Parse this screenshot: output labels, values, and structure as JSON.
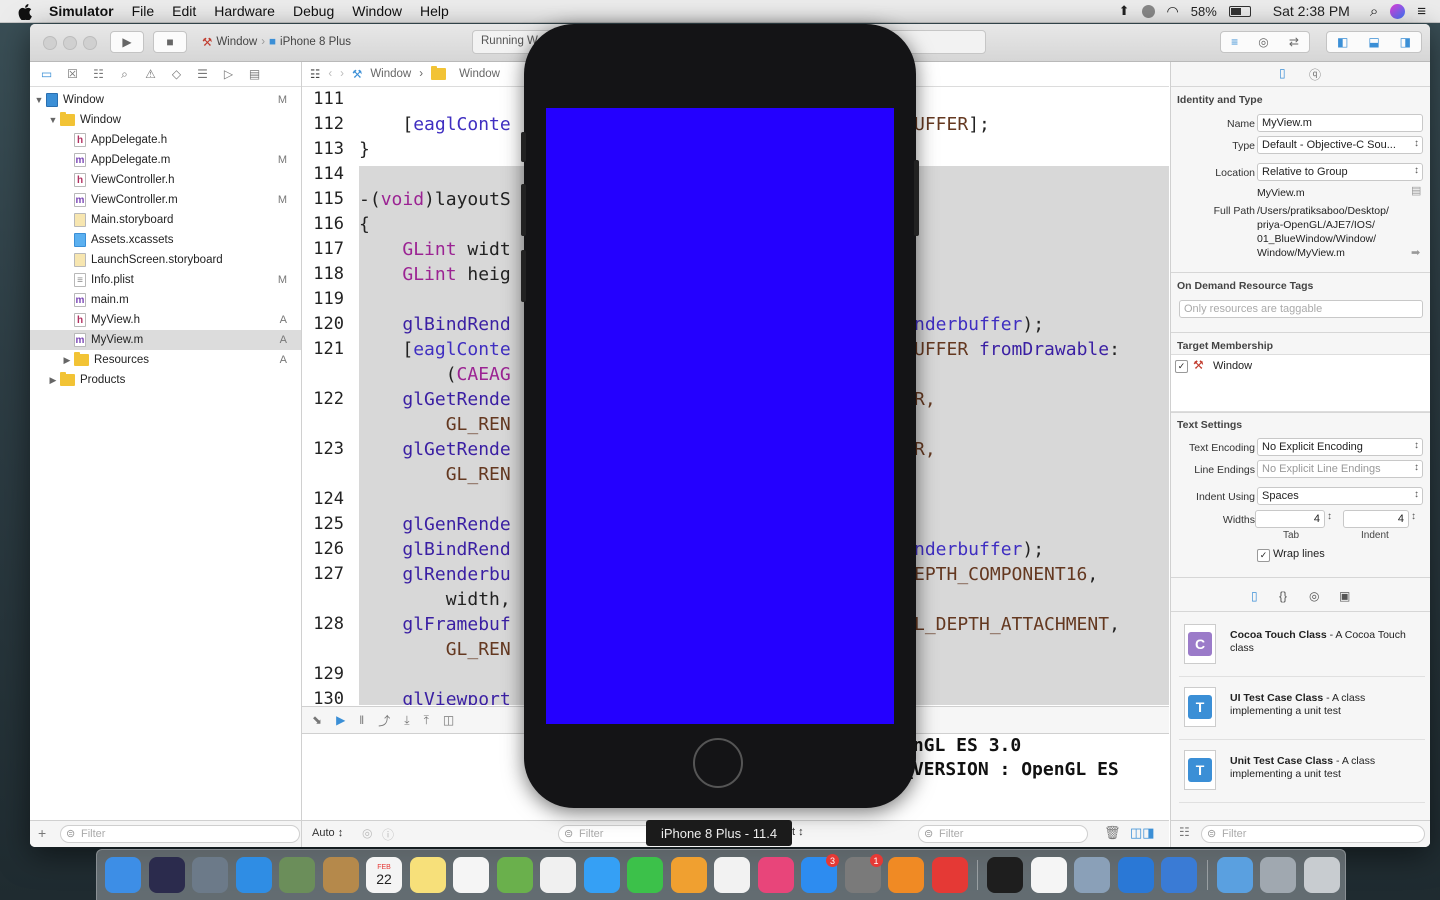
{
  "menubar": {
    "app_name": "Simulator",
    "items": [
      "File",
      "Edit",
      "Hardware",
      "Debug",
      "Window",
      "Help"
    ],
    "battery": "58%",
    "clock": "Sat 2:38 PM"
  },
  "toolbar": {
    "scheme": "Window",
    "device": "iPhone 8 Plus",
    "status": "Running W"
  },
  "navigator": {
    "items": [
      {
        "name": "Window",
        "badge": "M",
        "kind": "project"
      },
      {
        "name": "Window",
        "badge": "",
        "kind": "folder"
      },
      {
        "name": "AppDelegate.h",
        "badge": "",
        "kind": "h"
      },
      {
        "name": "AppDelegate.m",
        "badge": "M",
        "kind": "m"
      },
      {
        "name": "ViewController.h",
        "badge": "",
        "kind": "h"
      },
      {
        "name": "ViewController.m",
        "badge": "M",
        "kind": "m"
      },
      {
        "name": "Main.storyboard",
        "badge": "",
        "kind": "sb"
      },
      {
        "name": "Assets.xcassets",
        "badge": "",
        "kind": "assets"
      },
      {
        "name": "LaunchScreen.storyboard",
        "badge": "",
        "kind": "sb"
      },
      {
        "name": "Info.plist",
        "badge": "M",
        "kind": "plist"
      },
      {
        "name": "main.m",
        "badge": "",
        "kind": "m"
      },
      {
        "name": "MyView.h",
        "badge": "A",
        "kind": "h"
      },
      {
        "name": "MyView.m",
        "badge": "A",
        "kind": "m"
      },
      {
        "name": "Resources",
        "badge": "A",
        "kind": "folder"
      },
      {
        "name": "Products",
        "badge": "",
        "kind": "folder"
      }
    ],
    "filter_placeholder": "Filter"
  },
  "jumpbar": {
    "crumbs": [
      "Window",
      "Window"
    ]
  },
  "code": {
    "lines": [
      {
        "n": "111",
        "t": ""
      },
      {
        "n": "112",
        "t": "    [eaglConte"
      },
      {
        "n": "113",
        "t": "}"
      },
      {
        "n": "114",
        "t": ""
      },
      {
        "n": "115",
        "t": "-(void)layoutS"
      },
      {
        "n": "116",
        "t": "{"
      },
      {
        "n": "117",
        "t": "    GLint widt"
      },
      {
        "n": "118",
        "t": "    GLint heig"
      },
      {
        "n": "119",
        "t": ""
      },
      {
        "n": "120",
        "t": "    glBindRend"
      },
      {
        "n": "121",
        "t": "    [eaglConte"
      },
      {
        "n": "",
        "t": "        (CAEAG"
      },
      {
        "n": "122",
        "t": "    glGetRende"
      },
      {
        "n": "",
        "t": "        GL_REN"
      },
      {
        "n": "123",
        "t": "    glGetRende"
      },
      {
        "n": "",
        "t": "        GL_REN"
      },
      {
        "n": "124",
        "t": ""
      },
      {
        "n": "125",
        "t": "    glGenRende"
      },
      {
        "n": "126",
        "t": "    glBindRend"
      },
      {
        "n": "127",
        "t": "    glRenderbu"
      },
      {
        "n": "",
        "t": "        width,"
      },
      {
        "n": "128",
        "t": "    glFramebuf"
      },
      {
        "n": "",
        "t": "        GL_REN"
      },
      {
        "n": "129",
        "t": ""
      },
      {
        "n": "130",
        "t": "    glViewport"
      }
    ],
    "right_fragments": [
      {
        "row": 1,
        "t": "UFFER];"
      },
      {
        "row": 9,
        "t": "nderbuffer);"
      },
      {
        "row": 10,
        "t": "UFFER fromDrawable:"
      },
      {
        "row": 12,
        "t": "R,"
      },
      {
        "row": 14,
        "t": "R,"
      },
      {
        "row": 18,
        "t": "nderbuffer);"
      },
      {
        "row": 19,
        "t": "EPTH_COMPONENT16,"
      },
      {
        "row": 21,
        "t": "L_DEPTH_ATTACHMENT,"
      }
    ]
  },
  "console": {
    "line1": "enGL ES 3.0",
    "line2": "_VERSION : OpenGL ES"
  },
  "editor_bottom": {
    "auto_label": "Auto",
    "filter1": "Filter",
    "filter2": "Filter",
    "filter_frag": "t"
  },
  "inspector": {
    "identity_header": "Identity and Type",
    "name_label": "Name",
    "name_value": "MyView.m",
    "type_label": "Type",
    "type_value": "Default - Objective-C Sou...",
    "location_label": "Location",
    "location_value": "Relative to Group",
    "location_file": "MyView.m",
    "fullpath_label": "Full Path",
    "fullpath_lines": [
      "/Users/pratiksaboo/Desktop/",
      "priya-OpenGL/AJE7/IOS/",
      "01_BlueWindow/Window/",
      "Window/MyView.m"
    ],
    "ondemand_header": "On Demand Resource Tags",
    "tags_placeholder": "Only resources are taggable",
    "target_header": "Target Membership",
    "target_name": "Window",
    "text_header": "Text Settings",
    "encoding_label": "Text Encoding",
    "encoding_value": "No Explicit Encoding",
    "endings_label": "Line Endings",
    "endings_value": "No Explicit Line Endings",
    "indent_label": "Indent Using",
    "indent_value": "Spaces",
    "widths_label": "Widths",
    "tab_value": "4",
    "indent_width_value": "4",
    "tab_caption": "Tab",
    "indent_caption": "Indent",
    "wrap_label": "Wrap lines",
    "library": [
      {
        "title": "Cocoa Touch Class",
        "desc": " - A Cocoa Touch class",
        "letter": "C",
        "color": "#9b7bc9"
      },
      {
        "title": "UI Test Case Class",
        "desc": " - A class implementing a unit test",
        "letter": "T",
        "color": "#3b8fd6"
      },
      {
        "title": "Unit Test Case Class",
        "desc": " - A class implementing a unit test",
        "letter": "T",
        "color": "#3b8fd6"
      }
    ],
    "filter_placeholder": "Filter"
  },
  "simulator": {
    "label": "iPhone 8 Plus - 11.4",
    "screen_color": "#2400ff"
  },
  "dock": {
    "apps": [
      {
        "name": "finder-icon",
        "color": "#3d8ee6"
      },
      {
        "name": "siri-icon",
        "color": "#2b2b4d"
      },
      {
        "name": "launchpad-icon",
        "color": "#6c7a89"
      },
      {
        "name": "safari-icon",
        "color": "#2f8de4"
      },
      {
        "name": "preview-icon",
        "color": "#6b8e5a"
      },
      {
        "name": "contacts-icon",
        "color": "#b5894b"
      },
      {
        "name": "calendar-icon",
        "color": "#f4f4f4"
      },
      {
        "name": "notes-icon",
        "color": "#f7e07a"
      },
      {
        "name": "reminders-icon",
        "color": "#f5f5f5"
      },
      {
        "name": "maps-icon",
        "color": "#6ab04c"
      },
      {
        "name": "photos-icon",
        "color": "#f0f0f0"
      },
      {
        "name": "messages-icon",
        "color": "#35a0f5"
      },
      {
        "name": "facetime-icon",
        "color": "#3cc14a"
      },
      {
        "name": "pages-icon",
        "color": "#f0a030"
      },
      {
        "name": "numbers-icon",
        "color": "#f2f2f2"
      },
      {
        "name": "itunes-icon",
        "color": "#e8457a"
      },
      {
        "name": "appstore-icon",
        "color": "#2d8cf0"
      },
      {
        "name": "system-preferences-icon",
        "color": "#7a7a7a"
      },
      {
        "name": "books-icon",
        "color": "#f08a24"
      },
      {
        "name": "anydesk-icon",
        "color": "#e53935"
      },
      {
        "name": "terminal-icon",
        "color": "#1e1e1e"
      },
      {
        "name": "textedit-icon",
        "color": "#f5f5f5"
      },
      {
        "name": "image-capture-icon",
        "color": "#8aa0b8"
      },
      {
        "name": "xcode-icon",
        "color": "#2a78d6"
      },
      {
        "name": "instruments-icon",
        "color": "#3a7bd5"
      },
      {
        "name": "downloads-folder-icon",
        "color": "#5aa0e0"
      },
      {
        "name": "documents-stack-icon",
        "color": "#a0a8b0"
      },
      {
        "name": "trash-icon",
        "color": "#c8ccd0"
      }
    ],
    "calendar_month": "FEB",
    "calendar_day": "22",
    "appstore_badge": "3",
    "prefs_badge": "1"
  }
}
